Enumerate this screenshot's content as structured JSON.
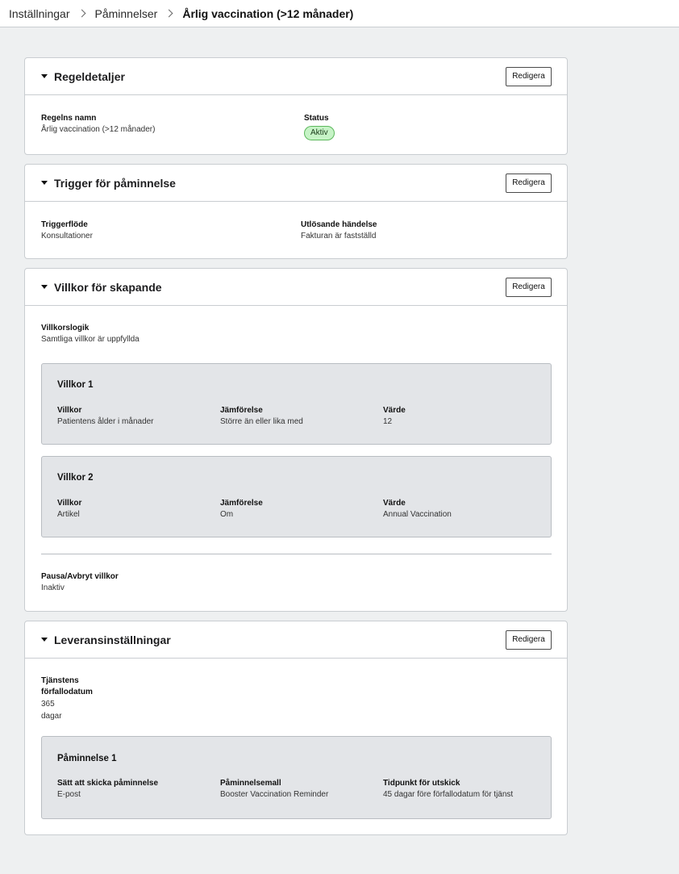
{
  "breadcrumb": {
    "items": [
      "Inställningar",
      "Påminnelser"
    ],
    "current": "Årlig vaccination (>12 månader)"
  },
  "edit_label": "Redigera",
  "rule_details": {
    "title": "Regeldetaljer",
    "name_label": "Regelns namn",
    "name_value": "Årlig vaccination (>12 månader)",
    "status_label": "Status",
    "status_value": "Aktiv"
  },
  "trigger": {
    "title": "Trigger för påminnelse",
    "flow_label": "Triggerflöde",
    "flow_value": "Konsultationer",
    "event_label": "Utlösande händelse",
    "event_value": "Fakturan är fastställd"
  },
  "conditions": {
    "title": "Villkor för skapande",
    "logic_label": "Villkorslogik",
    "logic_value": "Samtliga villkor är uppfyllda",
    "items": [
      {
        "title": "Villkor 1",
        "cond_label": "Villkor",
        "cond_value": "Patientens ålder i månader",
        "cmp_label": "Jämförelse",
        "cmp_value": "Större än eller lika med",
        "val_label": "Värde",
        "val_value": "12"
      },
      {
        "title": "Villkor 2",
        "cond_label": "Villkor",
        "cond_value": "Artikel",
        "cmp_label": "Jämförelse",
        "cmp_value": "Om",
        "val_label": "Värde",
        "val_value": "Annual Vaccination"
      }
    ],
    "pause_label": "Pausa/Avbryt villkor",
    "pause_value": "Inaktiv"
  },
  "delivery": {
    "title": "Leveransinställningar",
    "due_label_line1": "Tjänstens",
    "due_label_line2": "förfallodatum",
    "due_value": "365",
    "due_unit": "dagar",
    "reminders": [
      {
        "title": "Påminnelse 1",
        "method_label": "Sätt att skicka påminnelse",
        "method_value": "E-post",
        "template_label": "Påminnelsemall",
        "template_value": "Booster Vaccination Reminder",
        "time_label": "Tidpunkt för utskick",
        "time_value": "45 dagar före förfallodatum för tjänst"
      }
    ]
  },
  "colors": {
    "badge_bg": "#c6f3c6",
    "badge_border": "#5cb85c",
    "page_bg": "#eef0f1"
  }
}
